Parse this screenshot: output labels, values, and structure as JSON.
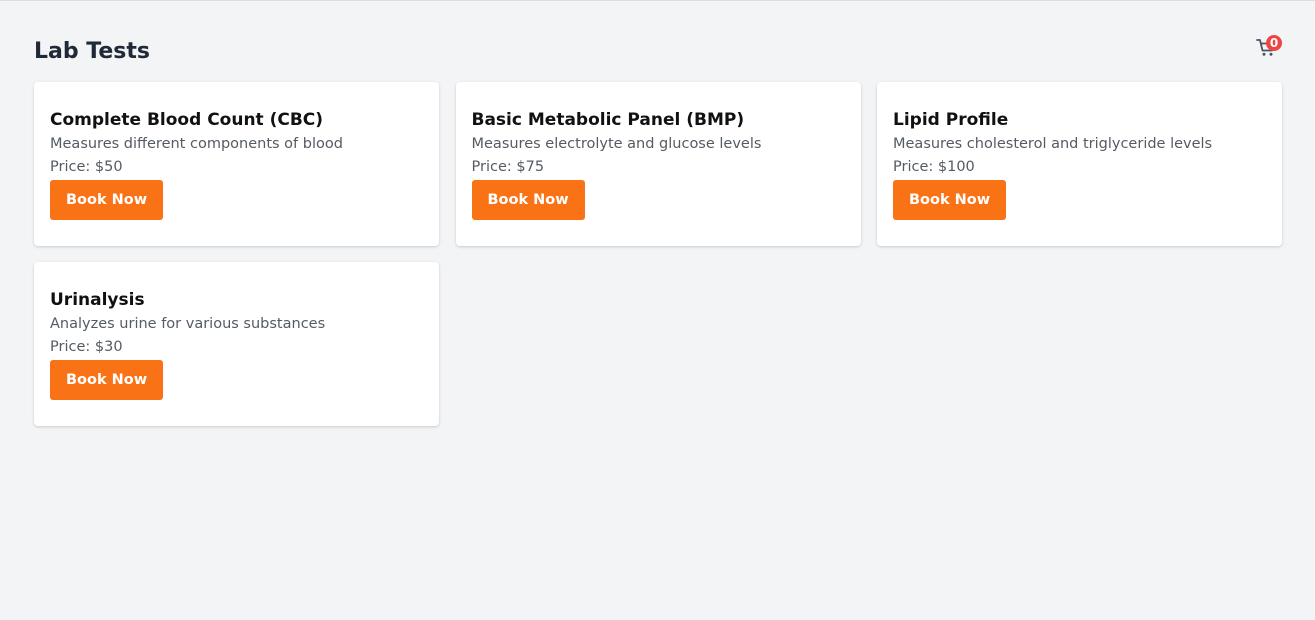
{
  "page": {
    "title": "Lab Tests"
  },
  "cart": {
    "icon": "cart-icon",
    "count": "0",
    "badge_color": "#ef4444"
  },
  "tests": [
    {
      "name": "Complete Blood Count (CBC)",
      "description": "Measures different components of blood",
      "price": "Price: $50",
      "button_label": "Book Now"
    },
    {
      "name": "Basic Metabolic Panel (BMP)",
      "description": "Measures electrolyte and glucose levels",
      "price": "Price: $75",
      "button_label": "Book Now"
    },
    {
      "name": "Lipid Profile",
      "description": "Measures cholesterol and triglyceride levels",
      "price": "Price: $100",
      "button_label": "Book Now"
    },
    {
      "name": "Urinalysis",
      "description": "Analyzes urine for various substances",
      "price": "Price: $30",
      "button_label": "Book Now"
    }
  ],
  "colors": {
    "accent": "#f97316",
    "background": "#f3f4f6",
    "card": "#ffffff"
  }
}
